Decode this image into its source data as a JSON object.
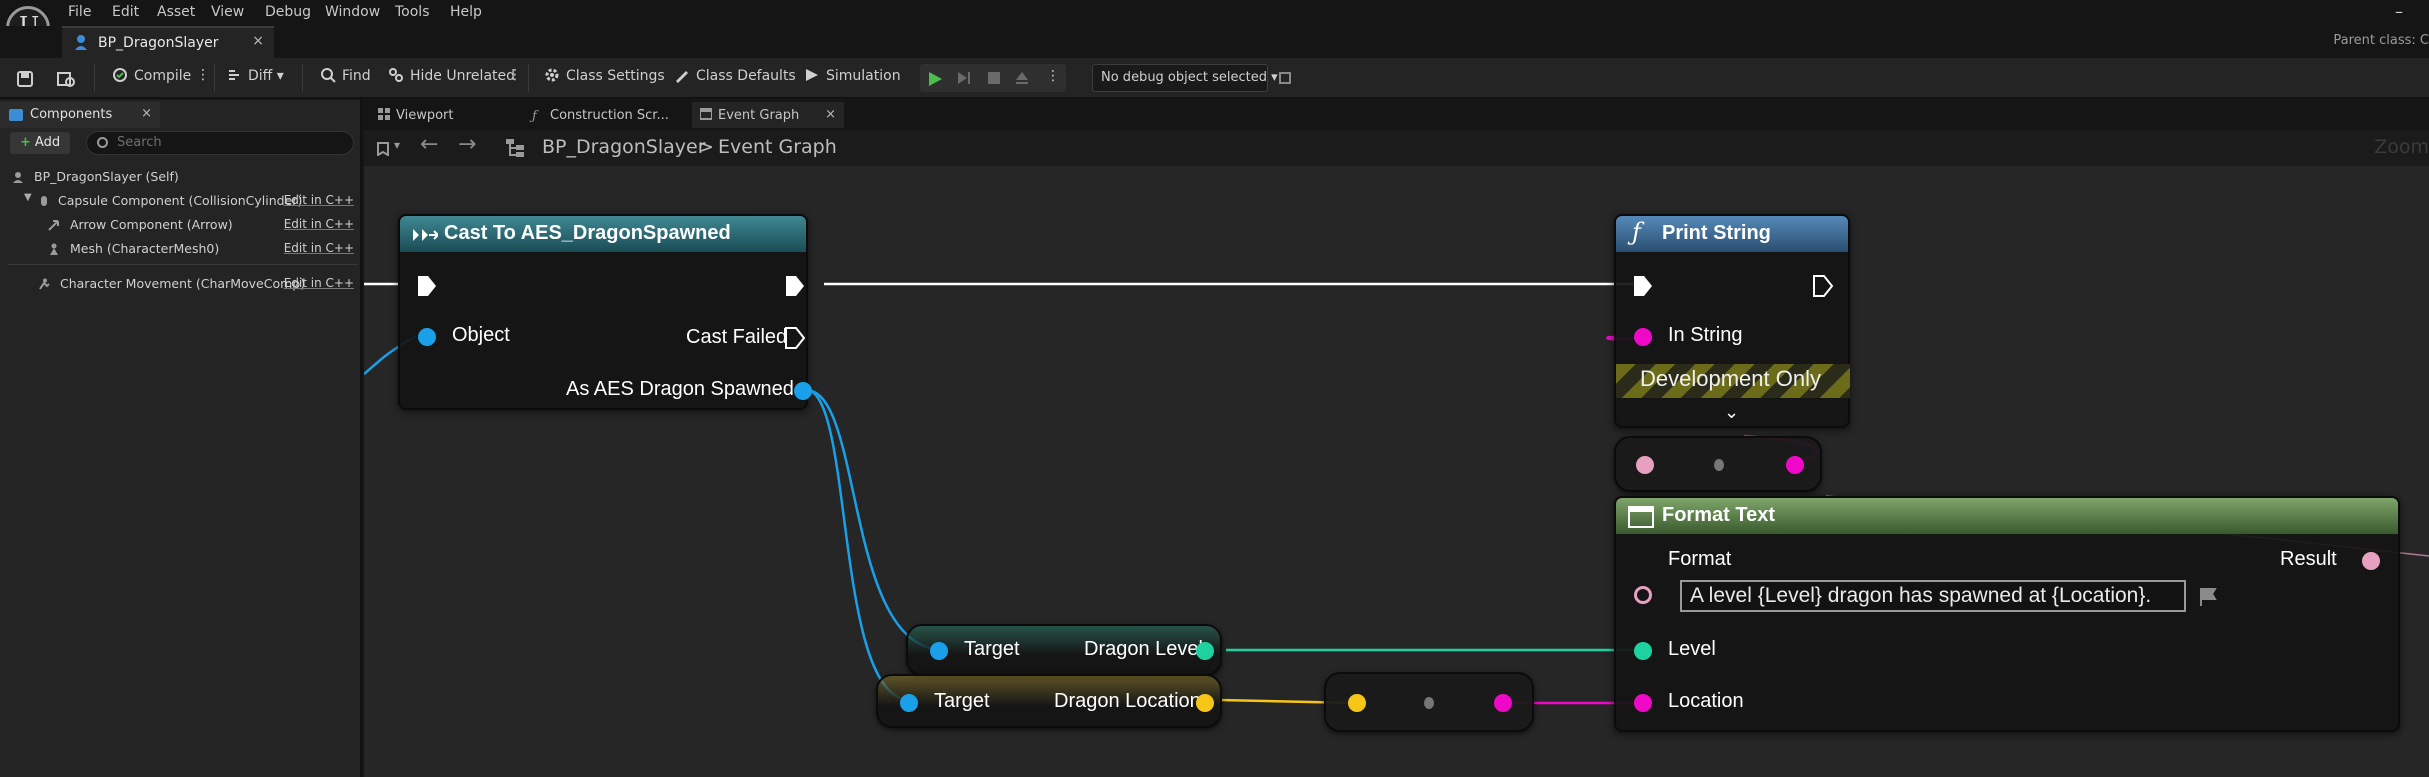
{
  "menu": [
    "File",
    "Edit",
    "Asset",
    "View",
    "Debug",
    "Window",
    "Tools",
    "Help"
  ],
  "window": {
    "minimize_glyph": "–",
    "parent_class_label": "Parent class: C"
  },
  "document_tab": {
    "label": "BP_DragonSlayer",
    "close": "×"
  },
  "toolbar": {
    "compile": "Compile",
    "diff": "Diff",
    "find": "Find",
    "hide_unrelated": "Hide Unrelated",
    "class_settings": "Class Settings",
    "class_defaults": "Class Defaults",
    "simulation": "Simulation",
    "debug_object": "No debug object selected"
  },
  "components_panel": {
    "tab_label": "Components",
    "close": "×",
    "add_label": "Add",
    "search_placeholder": "Search",
    "rows": [
      {
        "name": "BP_DragonSlayer (Self)",
        "edit": ""
      },
      {
        "name": "Capsule Component (CollisionCylinder)",
        "edit": "Edit in C++"
      },
      {
        "name": "Arrow Component (Arrow)",
        "edit": "Edit in C++"
      },
      {
        "name": "Mesh (CharacterMesh0)",
        "edit": "Edit in C++"
      },
      {
        "name": "Character Movement (CharMoveComp)",
        "edit": "Edit in C++"
      }
    ]
  },
  "graph_tabs": [
    {
      "label": "Viewport"
    },
    {
      "label": "Construction Scr..."
    },
    {
      "label": "Event Graph",
      "close": "×"
    }
  ],
  "breadcrumb": {
    "root": "BP_DragonSlayer",
    "separator": ">",
    "current": "Event Graph"
  },
  "zoom_label": "Zoom",
  "nodes": {
    "cast": {
      "title": "Cast To AES_DragonSpawned",
      "object_pin": "Object",
      "cast_failed": "Cast Failed",
      "as_output": "As AES Dragon Spawned"
    },
    "print_string": {
      "title": "Print String",
      "in_string": "In String",
      "dev_only": "Development Only"
    },
    "format_text": {
      "title": "Format Text",
      "format_label": "Format",
      "format_value": "A level {Level} dragon has spawned at {Location}.",
      "result": "Result",
      "level": "Level",
      "location": "Location"
    },
    "get_dragon_level": {
      "target": "Target",
      "output": "Dragon Level"
    },
    "get_dragon_location": {
      "target": "Target",
      "output": "Dragon Location"
    }
  },
  "colors": {
    "object_pin": "#1aa0e8",
    "text_pin": "#e8a0c0",
    "string_pin": "#f008c8",
    "int_pin": "#1ed2a0",
    "vector_pin": "#f5c518",
    "exec_wire": "#ffffff",
    "cast_header": "#2c6b7a",
    "function_header": "#3e6e9a",
    "pure_header": "#5c8a4a"
  }
}
